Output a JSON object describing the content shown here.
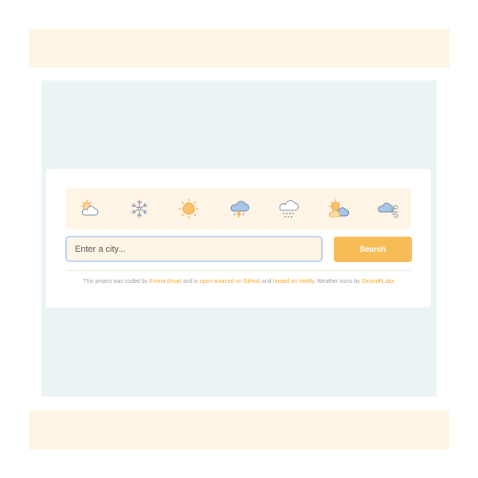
{
  "weather_icons": [
    {
      "name": "partly-sunny-icon"
    },
    {
      "name": "snowflake-icon"
    },
    {
      "name": "sun-icon"
    },
    {
      "name": "thunderstorm-icon"
    },
    {
      "name": "snow-cloud-icon"
    },
    {
      "name": "partly-cloudy-icon"
    },
    {
      "name": "windy-cloud-icon"
    }
  ],
  "search": {
    "placeholder": "Enter a city...",
    "button_label": "Search"
  },
  "footer": {
    "text_1": "This project was coded by ",
    "author_link": "Emma Smart",
    "text_2": " and is ",
    "github_link": "open-sourced on GitHub",
    "text_3": " and ",
    "netlify_link": "hosted on Netlify",
    "text_4": ". Weather icons by ",
    "icons_link": "DinosoftLabs"
  },
  "colors": {
    "band": "#fff5e6",
    "stage": "#ecf3f4",
    "accent": "#f8bc57",
    "link": "#f5a623",
    "input_border": "#bcd3ef"
  }
}
